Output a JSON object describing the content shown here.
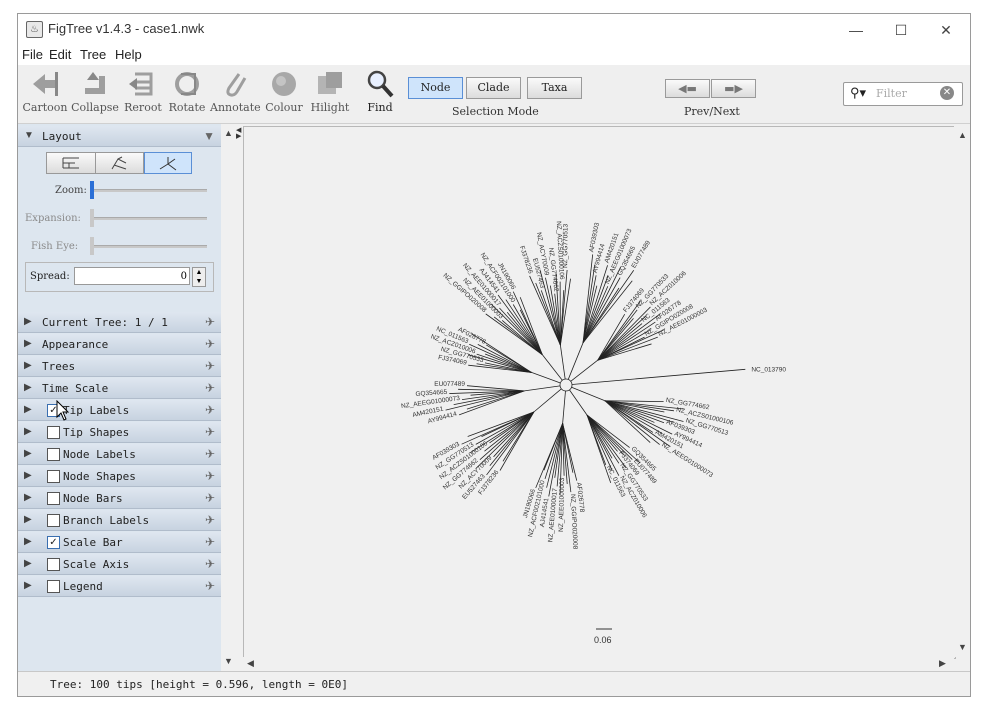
{
  "window": {
    "title": "FigTree v1.4.3 - case1.nwk"
  },
  "menu": [
    "File",
    "Edit",
    "Tree",
    "Help"
  ],
  "toolbar": {
    "tools": [
      "Cartoon",
      "Collapse",
      "Reroot",
      "Rotate",
      "Annotate",
      "Colour",
      "Hilight",
      "Find"
    ],
    "selection_modes": [
      "Node",
      "Clade",
      "Taxa"
    ],
    "selected_mode": "Node",
    "selection_caption": "Selection Mode",
    "prevnext_caption": "Prev/Next",
    "filter_placeholder": "Filter"
  },
  "sidebar": {
    "layout_title": "Layout",
    "zoom_label": "Zoom:",
    "expansion_label": "Expansion:",
    "fisheye_label": "Fish Eye:",
    "spread_label": "Spread:",
    "spread_value": "0",
    "zoom_fraction": 0.0,
    "sections": [
      {
        "name": "Current Tree: 1 / 1",
        "checkbox": null
      },
      {
        "name": "Appearance",
        "checkbox": null
      },
      {
        "name": "Trees",
        "checkbox": null
      },
      {
        "name": "Time Scale",
        "checkbox": null
      },
      {
        "name": "Tip Labels",
        "checkbox": true
      },
      {
        "name": "Tip Shapes",
        "checkbox": false
      },
      {
        "name": "Node Labels",
        "checkbox": false
      },
      {
        "name": "Node Shapes",
        "checkbox": false
      },
      {
        "name": "Node Bars",
        "checkbox": false
      },
      {
        "name": "Branch Labels",
        "checkbox": false
      },
      {
        "name": "Scale Bar",
        "checkbox": true
      },
      {
        "name": "Scale Axis",
        "checkbox": false
      },
      {
        "name": "Legend",
        "checkbox": false
      }
    ]
  },
  "tree": {
    "scale_label": "0.06",
    "labels": [
      "NC_013790",
      "NZ_GG774662",
      "NZ_ACZS01000106",
      "NZ_GG770513",
      "AF039303",
      "AY994414",
      "AM420151",
      "NZ_AEEG01000073",
      "GQ354665",
      "EU077489",
      "FJ374069",
      "NZ_GG770533",
      "NZ_ACZ010006",
      "NC_011563",
      "AF026778",
      "NZ_GGIPO020008",
      "NZ_AEE01000003",
      "NZ_AEE01000017",
      "AJ414541",
      "NZ_ACF002101000",
      "JN190066",
      "FJ378236",
      "EU527463",
      "NZ_ACY70009"
    ]
  },
  "status": "Tree: 100 tips [height = 0.596, length = 0E0]"
}
